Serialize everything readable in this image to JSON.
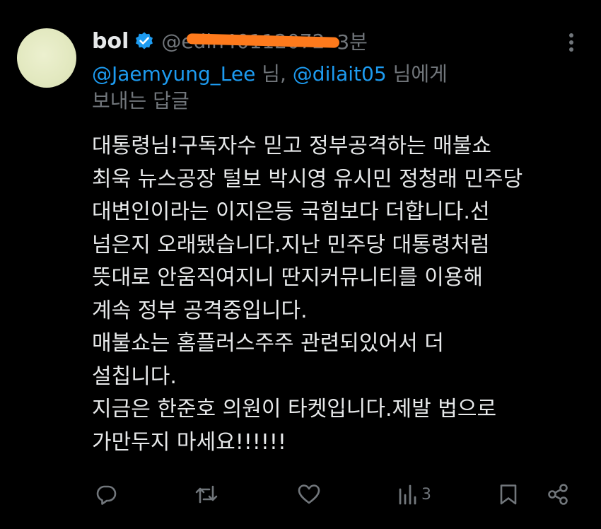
{
  "tweet": {
    "display_name": "bol",
    "handle": "@edin40112072",
    "time_sep": " ·",
    "time": "3분",
    "reply_to": {
      "mention1": "@Jaemyung_Lee",
      "mid": " 님, ",
      "mention2": "@dilait05",
      "end": " 님에게",
      "line2": "보내는 답글"
    },
    "body_lines": [
      "대통령님!구독자수 믿고 정부공격하는 매불쇼",
      "최욱 뉴스공장 털보 박시영 유시민 정청래 민주당",
      "대변인이라는 이지은등 국힘보다 더합니다.선",
      "넘은지 오래됐습니다.지난 민주당 대통령처럼",
      "뜻대로 안움직여지니 딴지커뮤니티를 이용해",
      "계속 정부 공격중입니다.",
      "매불쇼는 홈플러스주주 관련되있어서 더",
      "설칩니다.",
      "지금은 한준호 의원이 타켓입니다.제발 법으로",
      "가만두지 마세요!!!!!!"
    ],
    "views_count": "3"
  },
  "colors": {
    "background": "#000000",
    "text": "#e7e9ea",
    "secondary": "#71767b",
    "link": "#1d9bf0",
    "verified": "#1d9bf0",
    "redaction": "#fe7a1c"
  },
  "icons": {
    "verified": "verified-badge-icon",
    "more": "more-dots-icon",
    "reply": "reply-icon",
    "retweet": "retweet-icon",
    "like": "heart-icon",
    "views": "views-chart-icon",
    "bookmark": "bookmark-icon",
    "share": "share-icon"
  }
}
